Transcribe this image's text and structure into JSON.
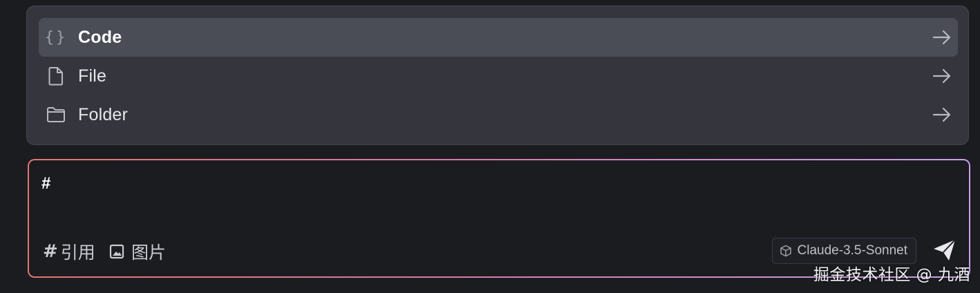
{
  "menu": {
    "items": [
      {
        "label": "Code",
        "icon": "braces-icon",
        "active": true
      },
      {
        "label": "File",
        "icon": "file-icon",
        "active": false
      },
      {
        "label": "Folder",
        "icon": "folder-icon",
        "active": false
      }
    ],
    "braces_glyph": "{}"
  },
  "input": {
    "value": "#"
  },
  "toolbar": {
    "reference_label": "引用",
    "reference_icon": "hash-icon",
    "reference_glyph": "#",
    "image_label": "图片",
    "image_icon": "image-icon",
    "model_label": "Claude-3.5-Sonnet",
    "model_icon": "cube-icon",
    "send_icon": "send-icon"
  },
  "watermark": "掘金技术社区 @ 九酒",
  "colors": {
    "background": "#1b1c20",
    "menu_bg": "#35363d",
    "active_item_bg": "#4a4c56",
    "border_gradient_start": "#e0776f",
    "border_gradient_end": "#c7a0ec"
  }
}
